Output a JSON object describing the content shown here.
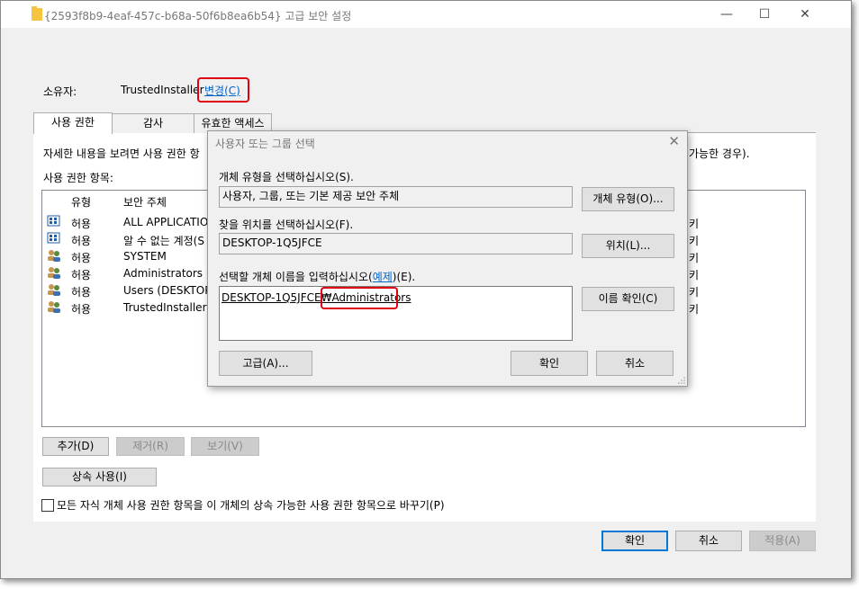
{
  "window": {
    "title": "{2593f8b9-4eaf-457c-b68a-50f6b8ea6b54} 고급 보안 설정",
    "minimize": "—",
    "maximize": "☐",
    "close": "✕"
  },
  "owner": {
    "label": "소유자:",
    "value": "TrustedInstaller",
    "change_link": "변경(C)"
  },
  "tabs": [
    "사용 권한",
    "감사",
    "유효한 액세스"
  ],
  "info_text": "자세한 내용을 보려면 사용 권한 항",
  "info_text_tail": "가능한 경우).",
  "entries_label": "사용 권한 항목:",
  "columns": {
    "type": "유형",
    "principal": "보안 주체"
  },
  "entries": [
    {
      "type": "허용",
      "principal": "ALL APPLICATION",
      "icon": "app-package-icon",
      "tail": "키"
    },
    {
      "type": "허용",
      "principal": "알 수 없는 계정(S",
      "icon": "app-package-icon",
      "tail": "키"
    },
    {
      "type": "허용",
      "principal": "SYSTEM",
      "icon": "group-users-icon",
      "tail": "키"
    },
    {
      "type": "허용",
      "principal": "Administrators (D",
      "icon": "group-users-icon",
      "tail": "키"
    },
    {
      "type": "허용",
      "principal": "Users (DESKTOP-",
      "icon": "group-users-icon",
      "tail": "키"
    },
    {
      "type": "허용",
      "principal": "TrustedInstaller",
      "icon": "group-users-icon",
      "tail": "키"
    }
  ],
  "buttons": {
    "add": "추가(D)",
    "remove": "제거(R)",
    "view": "보기(V)",
    "inherit": "상속 사용(I)",
    "ok": "확인",
    "cancel": "취소",
    "apply": "적용(A)"
  },
  "replace_checkbox": "모든 자식 개체 사용 권한 항목을 이 개체의 상속 가능한 사용 권한 항목으로 바꾸기(P)",
  "dialog": {
    "title": "사용자 또는 그룹 선택",
    "close": "✕",
    "object_type_label": "개체 유형을 선택하십시오(S).",
    "object_type_value": "사용자, 그룹, 또는 기본 제공 보안 주체",
    "object_type_button": "개체 유형(O)...",
    "location_label": "찾을 위치를 선택하십시오(F).",
    "location_value": "DESKTOP-1Q5JFCE",
    "location_button": "위치(L)...",
    "name_label_pre": "선택할 개체 이름을 입력하십시오(",
    "name_label_link": "예제",
    "name_label_post": ")(E).",
    "name_prefix": "DESKTOP-1Q5JFCE₩",
    "name_value": "Administrators",
    "check_names_button": "이름 확인(C)",
    "advanced_button": "고급(A)...",
    "ok_button": "확인",
    "cancel_button": "취소"
  },
  "colors": {
    "highlight_red": "#e0000f",
    "link_blue": "#0066cc",
    "accent": "#0078d7"
  }
}
